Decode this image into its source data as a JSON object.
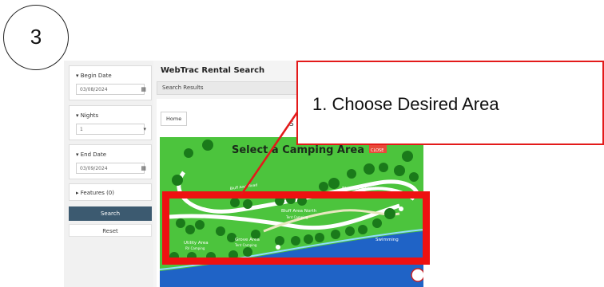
{
  "step": {
    "number": "3"
  },
  "callout": {
    "text": "1.   Choose Desired Area"
  },
  "app": {
    "title": "WebTrac Rental Search"
  },
  "breadcrumb": {
    "label": "Search Results"
  },
  "content": {
    "home_tab": "Home",
    "partial_text": "S"
  },
  "sidebar": {
    "begin_date": {
      "label": "Begin Date",
      "value": "03/08/2024"
    },
    "nights": {
      "label": "Nights",
      "value": "1"
    },
    "end_date": {
      "label": "End Date",
      "value": "03/09/2024"
    },
    "features": {
      "label": "Features (0)"
    },
    "search_label": "Search",
    "reset_label": "Reset"
  },
  "map": {
    "title": "Select a Camping Area",
    "close_label": "CLOSE",
    "area_labels": {
      "bluff_south": "Bluff Area South",
      "bluff_north": "Bluff Area North",
      "bluff_north_sub": "Tent Camping",
      "utility": "Utility Area",
      "utility_sub": "RV Camping",
      "grove": "Grove Area",
      "grove_sub": "Tent Camping",
      "swimming": "Swimming",
      "road": "Bluff Area Road"
    }
  },
  "colors": {
    "callout_border": "#e31a1a",
    "highlight": "#ee1111",
    "search_button": "#3c5a70",
    "map_grass": "#4cc43d",
    "map_water": "#1f63c6"
  }
}
